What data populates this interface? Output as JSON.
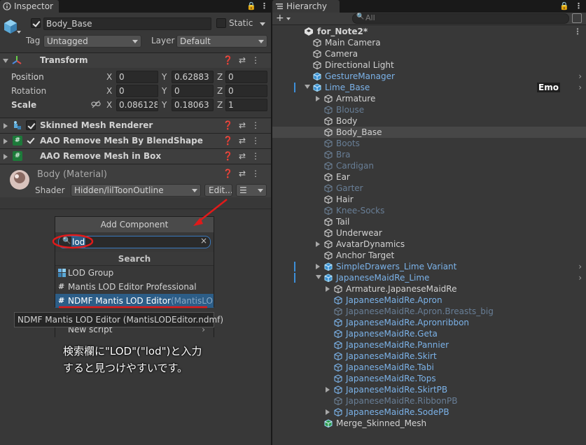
{
  "inspector": {
    "tab_label": "Inspector",
    "object_name": "Body_Base",
    "static_label": "Static",
    "tag_label": "Tag",
    "tag_value": "Untagged",
    "layer_label": "Layer",
    "layer_value": "Default",
    "transform": {
      "title": "Transform",
      "position_label": "Position",
      "rotation_label": "Rotation",
      "scale_label": "Scale",
      "position": {
        "x": "0",
        "y": "0.62883",
        "z": "0"
      },
      "rotation": {
        "x": "0",
        "y": "0",
        "z": "0"
      },
      "scale": {
        "x": "0.086128",
        "y": "0.18063",
        "z": "1"
      },
      "x_label": "X",
      "y_label": "Y",
      "z_label": "Z"
    },
    "components": [
      {
        "title": "Skinned Mesh Renderer"
      },
      {
        "title": "AAO Remove Mesh By BlendShape"
      },
      {
        "title": "AAO Remove Mesh in Box"
      }
    ],
    "material": {
      "name": "Body (Material)",
      "shader_label": "Shader",
      "shader_value": "Hidden/lilToonOutline",
      "edit_label": "Edit...",
      "list_icon_label": "☰"
    }
  },
  "add_component": {
    "title": "Add Component",
    "search_value": "lod",
    "section": "Search",
    "results": [
      {
        "label": "LOD Group",
        "icon": "lod-group-icon"
      },
      {
        "label": "Mantis LOD Editor Professional",
        "icon": "script-icon"
      },
      {
        "label": "NDMF Mantis LOD Editor",
        "suffix": "(MantisLOD",
        "icon": "script-icon"
      }
    ],
    "tooltip": "NDMF Mantis LOD Editor (MantisLODEditor.ndmf)",
    "new_script_label": "New script",
    "annotation_line1": "検索欄に\"LOD\"(\"lod\")と入力",
    "annotation_line2": "すると見つけやすいです。"
  },
  "hierarchy": {
    "tab_label": "Hierarchy",
    "search_placeholder": "All",
    "scene_name": "for_Note2*",
    "emo_badge": "Emo",
    "items": [
      {
        "label": "Main Camera",
        "style": "white",
        "depth": 1
      },
      {
        "label": "Camera",
        "style": "white",
        "depth": 1
      },
      {
        "label": "Directional Light",
        "style": "white",
        "depth": 1
      },
      {
        "label": "GestureManager",
        "style": "blue",
        "depth": 1
      },
      {
        "label": "Lime_Base",
        "style": "blue",
        "depth": 1
      },
      {
        "label": "Armature",
        "style": "white",
        "depth": 2
      },
      {
        "label": "Blouse",
        "style": "faded",
        "depth": 2
      },
      {
        "label": "Body",
        "style": "white",
        "depth": 2
      },
      {
        "label": "Body_Base",
        "style": "white",
        "depth": 2
      },
      {
        "label": "Boots",
        "style": "faded",
        "depth": 2
      },
      {
        "label": "Bra",
        "style": "faded",
        "depth": 2
      },
      {
        "label": "Cardigan",
        "style": "faded",
        "depth": 2
      },
      {
        "label": "Ear",
        "style": "white",
        "depth": 2
      },
      {
        "label": "Garter",
        "style": "faded",
        "depth": 2
      },
      {
        "label": "Hair",
        "style": "white",
        "depth": 2
      },
      {
        "label": "Knee-Socks",
        "style": "faded",
        "depth": 2
      },
      {
        "label": "Tail",
        "style": "white",
        "depth": 2
      },
      {
        "label": "Underwear",
        "style": "white",
        "depth": 2
      },
      {
        "label": "AvatarDynamics",
        "style": "white",
        "depth": 2
      },
      {
        "label": "Anchor Target",
        "style": "white",
        "depth": 2
      },
      {
        "label": "SimpleDrawers_Lime Variant",
        "style": "blue",
        "depth": 2
      },
      {
        "label": "JapaneseMaidRe_Lime",
        "style": "blue",
        "depth": 2
      },
      {
        "label": "Armature.JapaneseMaidRe",
        "style": "white",
        "depth": 3
      },
      {
        "label": "JapaneseMaidRe.Apron",
        "style": "blue",
        "depth": 3
      },
      {
        "label": "JapaneseMaidRe.Apron.Breasts_big",
        "style": "faded",
        "depth": 3
      },
      {
        "label": "JapaneseMaidRe.Apronribbon",
        "style": "blue",
        "depth": 3
      },
      {
        "label": "JapaneseMaidRe.Geta",
        "style": "blue",
        "depth": 3
      },
      {
        "label": "JapaneseMaidRe.Pannier",
        "style": "blue",
        "depth": 3
      },
      {
        "label": "JapaneseMaidRe.Skirt",
        "style": "blue",
        "depth": 3
      },
      {
        "label": "JapaneseMaidRe.Tabi",
        "style": "blue",
        "depth": 3
      },
      {
        "label": "JapaneseMaidRe.Tops",
        "style": "blue",
        "depth": 3
      },
      {
        "label": "JapaneseMaidRe.SkirtPB",
        "style": "blue",
        "depth": 3
      },
      {
        "label": "JapaneseMaidRe.RibbonPB",
        "style": "faded",
        "depth": 3
      },
      {
        "label": "JapaneseMaidRe.SodePB",
        "style": "blue",
        "depth": 3
      },
      {
        "label": "Merge_Skinned_Mesh",
        "style": "white",
        "depth": 2
      }
    ]
  },
  "colors": {
    "accent_red": "#e01a1a",
    "selection_blue": "#2c5d87",
    "prefab_blue": "#7bb2e8"
  }
}
